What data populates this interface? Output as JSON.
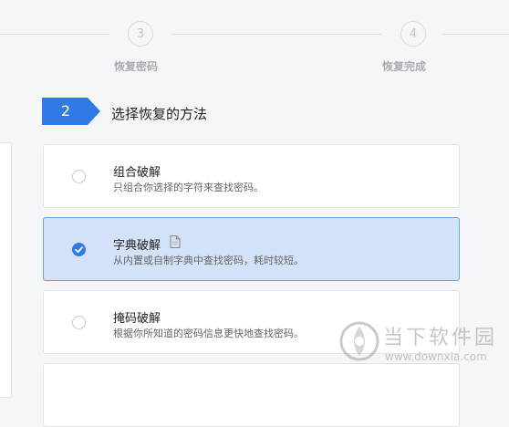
{
  "stepper": {
    "steps": [
      {
        "number": "3",
        "label": "恢复密码"
      },
      {
        "number": "4",
        "label": "恢复完成"
      }
    ]
  },
  "section": {
    "number": "2",
    "title": "选择恢复的方法",
    "accent_color": "#2f7ae5"
  },
  "methods": [
    {
      "title": "组合破解",
      "description": "只组合你选择的字符来查找密码。",
      "selected": false
    },
    {
      "title": "字典破解",
      "description": "从内置或自制字典中查找密码，耗时较短。",
      "selected": true,
      "icon": "document-icon"
    },
    {
      "title": "掩码破解",
      "description": "根据你所知道的密码信息更快地查找密码。",
      "selected": false
    },
    {
      "title": "",
      "description": "",
      "selected": false
    }
  ],
  "watermark": {
    "brand": "当下软件园",
    "url": "www.downxia.com"
  }
}
